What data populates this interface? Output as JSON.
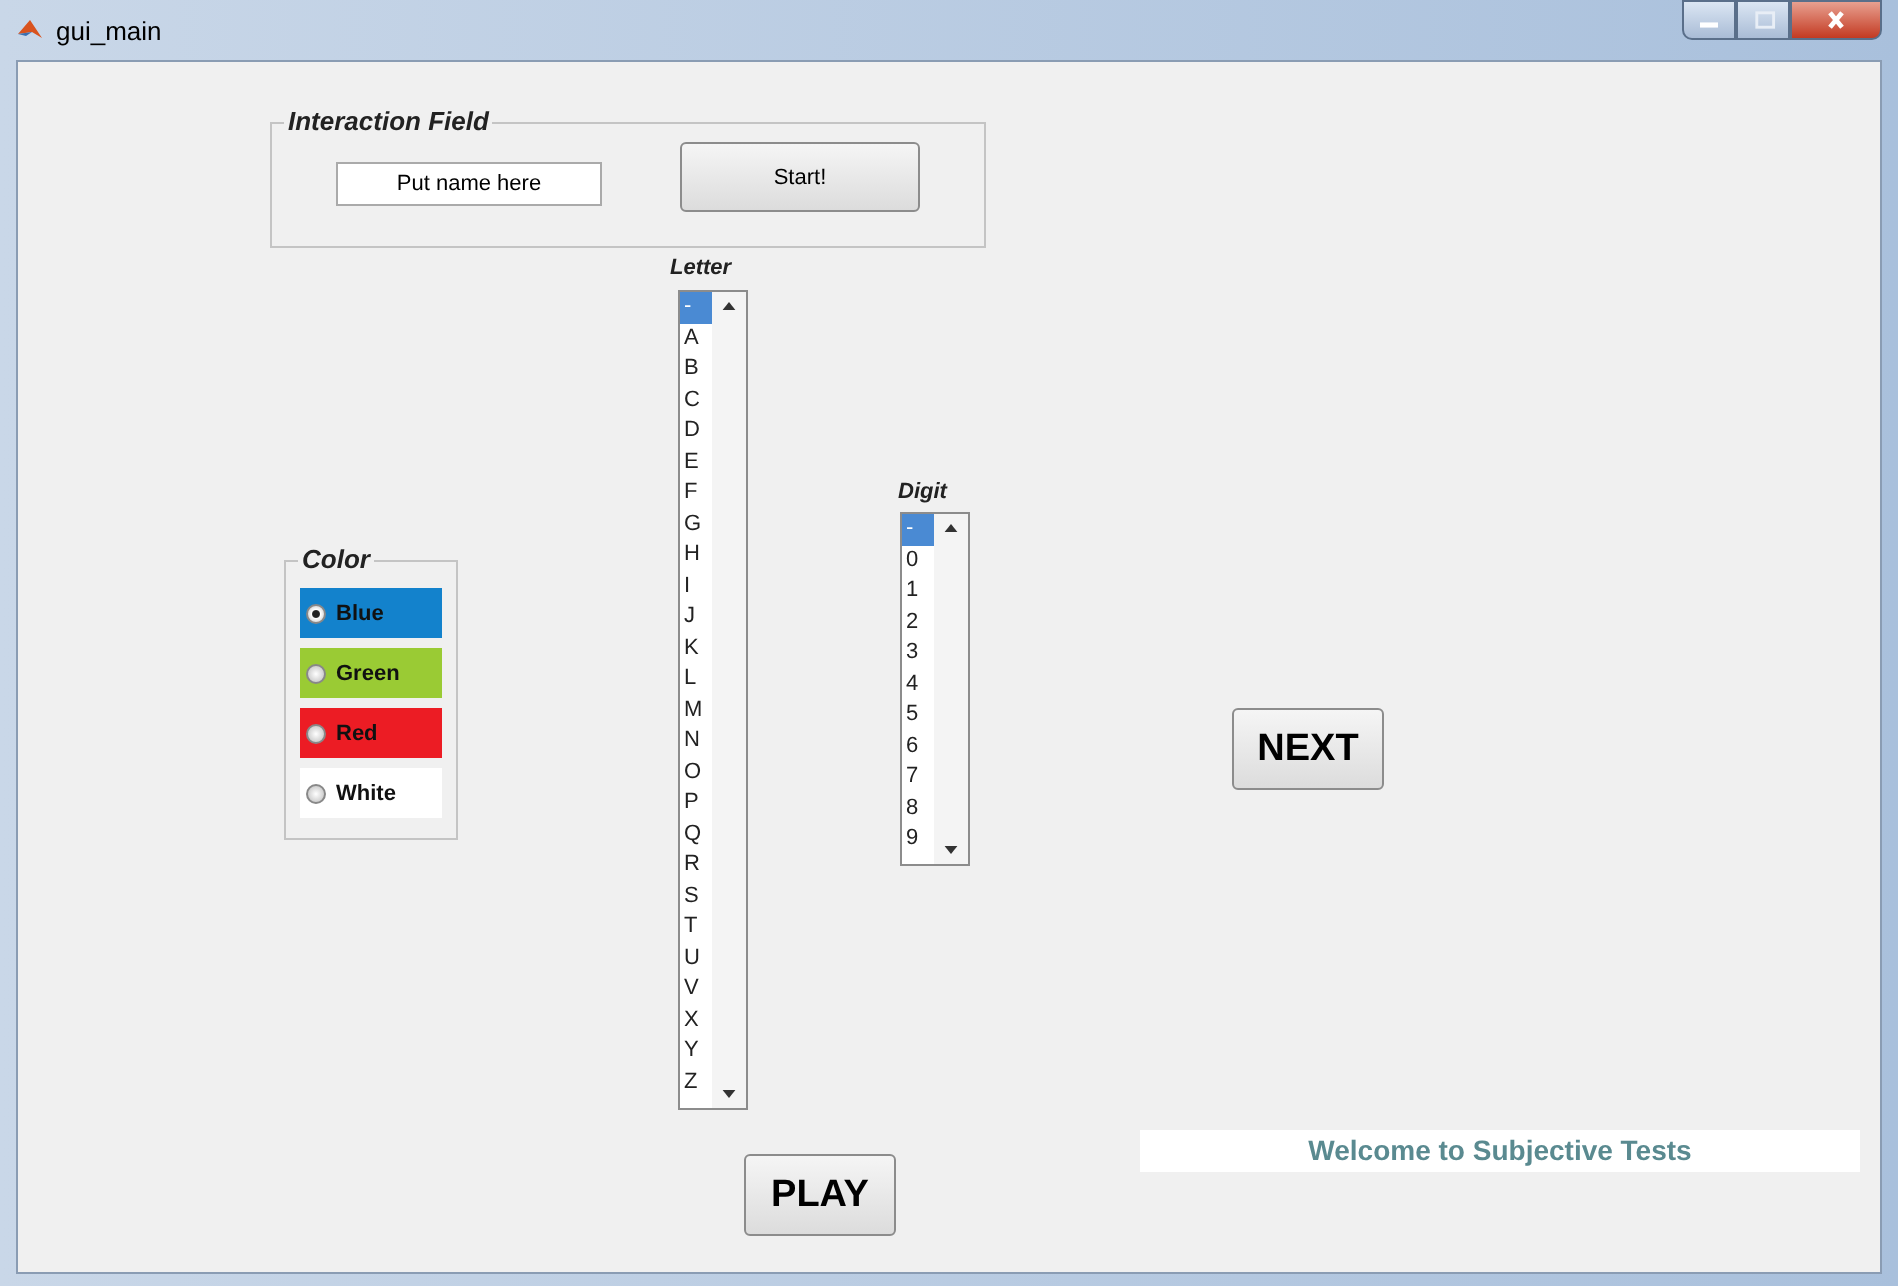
{
  "window": {
    "title": "gui_main"
  },
  "interaction_field": {
    "title": "Interaction Field",
    "name_field": {
      "value": "Put name here"
    },
    "start_button": "Start!"
  },
  "letter_list": {
    "label": "Letter",
    "items": [
      {
        "text": "-",
        "selected": true
      },
      {
        "text": "A",
        "selected": false
      },
      {
        "text": "B",
        "selected": false
      },
      {
        "text": "C",
        "selected": false
      },
      {
        "text": "D",
        "selected": false
      },
      {
        "text": "E",
        "selected": false
      },
      {
        "text": "F",
        "selected": false
      },
      {
        "text": "G",
        "selected": false
      },
      {
        "text": "H",
        "selected": false
      },
      {
        "text": "I",
        "selected": false
      },
      {
        "text": "J",
        "selected": false
      },
      {
        "text": "K",
        "selected": false
      },
      {
        "text": "L",
        "selected": false
      },
      {
        "text": "M",
        "selected": false
      },
      {
        "text": "N",
        "selected": false
      },
      {
        "text": "O",
        "selected": false
      },
      {
        "text": "P",
        "selected": false
      },
      {
        "text": "Q",
        "selected": false
      },
      {
        "text": "R",
        "selected": false
      },
      {
        "text": "S",
        "selected": false
      },
      {
        "text": "T",
        "selected": false
      },
      {
        "text": "U",
        "selected": false
      },
      {
        "text": "V",
        "selected": false
      },
      {
        "text": "X",
        "selected": false
      },
      {
        "text": "Y",
        "selected": false
      },
      {
        "text": "Z",
        "selected": false
      }
    ]
  },
  "digit_list": {
    "label": "Digit",
    "items": [
      {
        "text": "-",
        "selected": true
      },
      {
        "text": "0",
        "selected": false
      },
      {
        "text": "1",
        "selected": false
      },
      {
        "text": "2",
        "selected": false
      },
      {
        "text": "3",
        "selected": false
      },
      {
        "text": "4",
        "selected": false
      },
      {
        "text": "5",
        "selected": false
      },
      {
        "text": "6",
        "selected": false
      },
      {
        "text": "7",
        "selected": false
      },
      {
        "text": "8",
        "selected": false
      },
      {
        "text": "9",
        "selected": false
      }
    ]
  },
  "color_group": {
    "title": "Color",
    "options": [
      {
        "label": "Blue",
        "color": "#1382cc",
        "selected": true
      },
      {
        "label": "Green",
        "color": "#9acb34",
        "selected": false
      },
      {
        "label": "Red",
        "color": "#ec1c24",
        "selected": false
      },
      {
        "label": "White",
        "color": "#ffffff",
        "selected": false
      }
    ]
  },
  "next_button": "NEXT",
  "play_button": "PLAY",
  "status_text": "Welcome to Subjective Tests"
}
